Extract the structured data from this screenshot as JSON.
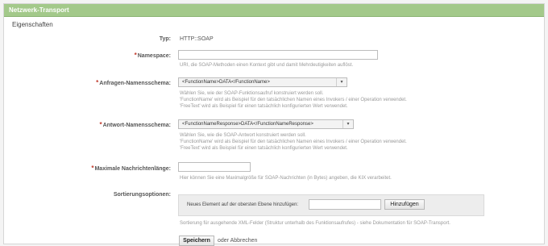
{
  "section": {
    "title": "Netzwerk-Transport",
    "subtitle": "Eigenschaften"
  },
  "type_row": {
    "label": "Typ:",
    "value": "HTTP::SOAP"
  },
  "namespace": {
    "required_mark": "*",
    "label": "Namespace:",
    "value": "",
    "help": "URI, die SOAP-Methoden einen Kontext gibt und damit Mehrdeutigkeiten auflöst."
  },
  "request_scheme": {
    "required_mark": "*",
    "label": "Anfragen-Namensschema:",
    "selected": "<FunctionName>DATA</FunctionName>",
    "help": [
      "Wählen Sie, wie der SOAP-Funktionsaufruf konstruiert werden soll.",
      "'FunctionName' wird als Beispiel für den tatsächlichen Namen eines Invokers / einer Operation verwendet.",
      "'FreeText' wird als Beispiel für einen tatsächlich konfigurierten Wert verwendet."
    ]
  },
  "response_scheme": {
    "required_mark": "*",
    "label": "Antwort-Namensschema:",
    "selected": "<FunctionNameResponse>DATA</FunctionNameResponse>",
    "help": [
      "Wählen Sie, wie die SOAP-Antwort konstruiert werden soll.",
      "'FunctionName' wird als Beispiel für den tatsächlichen Namen eines Invokers / einer Operation verwendet.",
      "'FreeText' wird als Beispiel für einen tatsächlich konfigurierten Wert verwendet."
    ]
  },
  "max_length": {
    "required_mark": "*",
    "label": "Maximale Nachrichtenlänge:",
    "value": "",
    "help": "Hier können Sie eine Maximalgröße für SOAP-Nachrichten (in Bytes) angeben, die KIX verarbeitet."
  },
  "sort_options": {
    "label": "Sortierungsoptionen:",
    "add_label": "Neues Element auf der obersten Ebene hinzufügen:",
    "add_value": "",
    "add_button": "Hinzufügen",
    "help": "Sortierung für ausgehende XML-Felder (Struktur unterhalb des Funktionsaufrufes) - siehe Dokumentation für SOAP-Transport."
  },
  "footer": {
    "save_button": "Speichern",
    "or_text": "oder",
    "cancel_link": "Abbrechen"
  },
  "colors": {
    "header_bg": "#a3c98a",
    "required": "#c0392b"
  }
}
